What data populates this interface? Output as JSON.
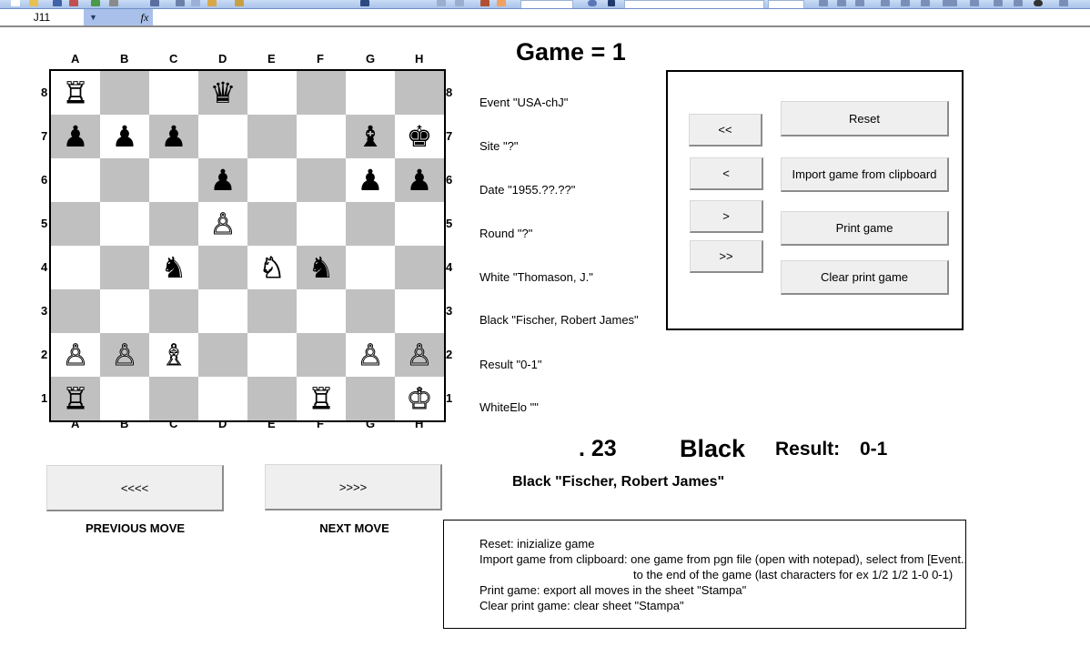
{
  "excel": {
    "name_box": "J11",
    "formula_icon": "fx-icon",
    "formula_value": ""
  },
  "board": {
    "files": [
      "A",
      "B",
      "C",
      "D",
      "E",
      "F",
      "G",
      "H"
    ],
    "ranks": [
      "8",
      "7",
      "6",
      "5",
      "4",
      "3",
      "2",
      "1"
    ],
    "light_color": "#ffffff",
    "dark_color": "#c0c0c0",
    "pieces": [
      {
        "square": "a8",
        "piece": "rook",
        "color": "white"
      },
      {
        "square": "d8",
        "piece": "queen",
        "color": "black"
      },
      {
        "square": "a7",
        "piece": "pawn",
        "color": "black"
      },
      {
        "square": "b7",
        "piece": "pawn",
        "color": "black"
      },
      {
        "square": "c7",
        "piece": "pawn",
        "color": "black"
      },
      {
        "square": "g7",
        "piece": "bishop",
        "color": "black"
      },
      {
        "square": "h7",
        "piece": "king",
        "color": "black"
      },
      {
        "square": "d6",
        "piece": "pawn",
        "color": "black"
      },
      {
        "square": "g6",
        "piece": "pawn",
        "color": "black"
      },
      {
        "square": "h6",
        "piece": "pawn",
        "color": "black"
      },
      {
        "square": "d5",
        "piece": "pawn",
        "color": "white"
      },
      {
        "square": "c4",
        "piece": "knight",
        "color": "black"
      },
      {
        "square": "e4",
        "piece": "knight",
        "color": "white"
      },
      {
        "square": "f4",
        "piece": "knight",
        "color": "black"
      },
      {
        "square": "a2",
        "piece": "pawn",
        "color": "white"
      },
      {
        "square": "b2",
        "piece": "pawn",
        "color": "white"
      },
      {
        "square": "c2",
        "piece": "bishop",
        "color": "white"
      },
      {
        "square": "g2",
        "piece": "pawn",
        "color": "white"
      },
      {
        "square": "h2",
        "piece": "pawn",
        "color": "white"
      },
      {
        "square": "a1",
        "piece": "rook",
        "color": "white"
      },
      {
        "square": "f1",
        "piece": "rook",
        "color": "white"
      },
      {
        "square": "h1",
        "piece": "king",
        "color": "white"
      }
    ]
  },
  "game": {
    "title": "Game = 1",
    "tags": [
      "Event \"USA-chJ\"",
      "Site \"?\"",
      "Date \"1955.??.??\"",
      "Round \"?\"",
      "White \"Thomason, J.\"",
      "Black \"Fischer, Robert James\"",
      "Result \"0-1\"",
      "WhiteElo \"\""
    ],
    "move_number": ". 23",
    "side_to_move": "Black",
    "result_label": "Result:",
    "result_value": "0-1",
    "current_player": "Black \"Fischer, Robert James\""
  },
  "controls": {
    "first_label": "<<",
    "prev_label": "<",
    "next_label": ">",
    "last_label": ">>",
    "reset_label": "Reset",
    "import_label": "Import game from clipboard",
    "print_label": "Print game",
    "clear_print_label": "Clear print game",
    "previous_move_button": "<<<<",
    "next_move_button": ">>>>",
    "previous_move_caption": "PREVIOUS MOVE",
    "next_move_caption": "NEXT MOVE"
  },
  "help": {
    "lines": [
      "Reset: inizialize game",
      "Import game from clipboard: one game from pgn file (open with notepad), select from [Event..",
      "to the end of the game (last characters for ex 1/2 1/2 1-0 0-1)",
      "Print game: export all moves in the sheet \"Stampa\"",
      "Clear print game: clear sheet \"Stampa\""
    ]
  }
}
